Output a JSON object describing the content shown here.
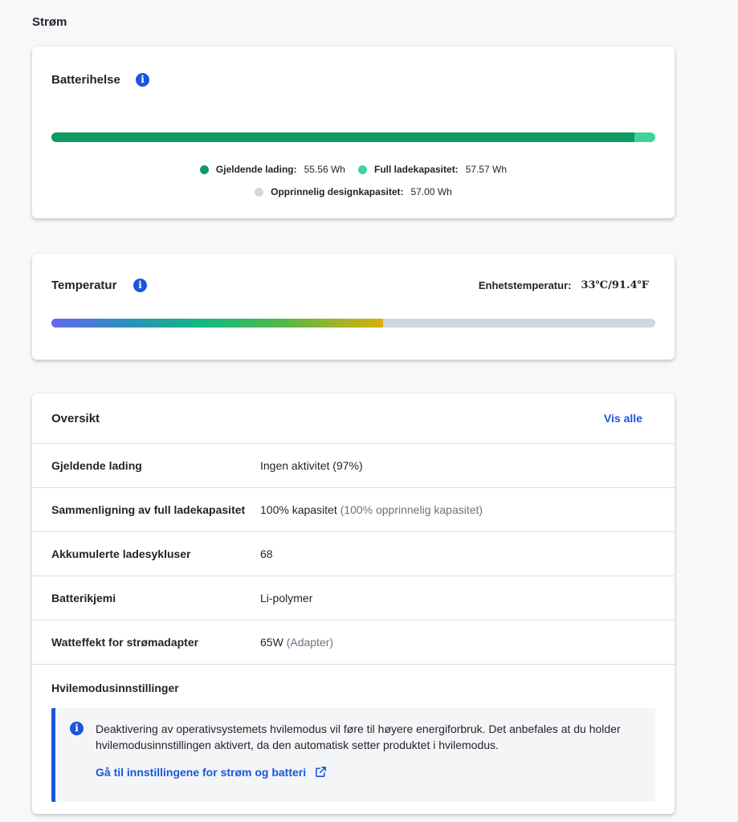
{
  "section_title": "Strøm",
  "battery": {
    "title": "Batterihelse",
    "info_icon": "i",
    "bar_fraction": 0.965,
    "colors": {
      "current": "#0e9a61",
      "full": "#3ed39a",
      "design": "#d1d7de"
    },
    "legend": {
      "current_label": "Gjeldende lading:",
      "current_value": "55.56 Wh",
      "full_label": "Full ladekapasitet:",
      "full_value": "57.57 Wh",
      "design_label": "Opprinnelig designkapasitet:",
      "design_value": "57.00 Wh"
    }
  },
  "temperature": {
    "title": "Temperatur",
    "info_icon": "i",
    "device_label": "Enhetstemperatur:",
    "device_value": "33℃/91.4℉",
    "bar_fraction": 0.549
  },
  "overview": {
    "title": "Oversikt",
    "view_all": "Vis alle",
    "rows": [
      {
        "key": "Gjeldende lading",
        "value": "Ingen aktivitet (97%)",
        "note": ""
      },
      {
        "key": "Sammenligning av full ladekapasitet",
        "value": "100% kapasitet",
        "note": "(100% opprinnelig kapasitet)"
      },
      {
        "key": "Akkumulerte ladesykluser",
        "value": "68",
        "note": ""
      },
      {
        "key": "Batterikjemi",
        "value": "Li-polymer",
        "note": ""
      },
      {
        "key": "Watteffekt for strømadapter",
        "value": "65W",
        "note": "(Adapter)"
      }
    ],
    "sleep_title": "Hvilemodusinnstillinger",
    "notice_text": "Deaktivering av operativsystemets hvilemodus vil føre til høyere energiforbruk. Det anbefales at du holder hvilemodusinnstillingen aktivert, da den automatisk setter produktet i hvilemodus.",
    "notice_link": "Gå til innstillingene for strøm og batteri",
    "notice_link_icon": "external-link-icon"
  }
}
